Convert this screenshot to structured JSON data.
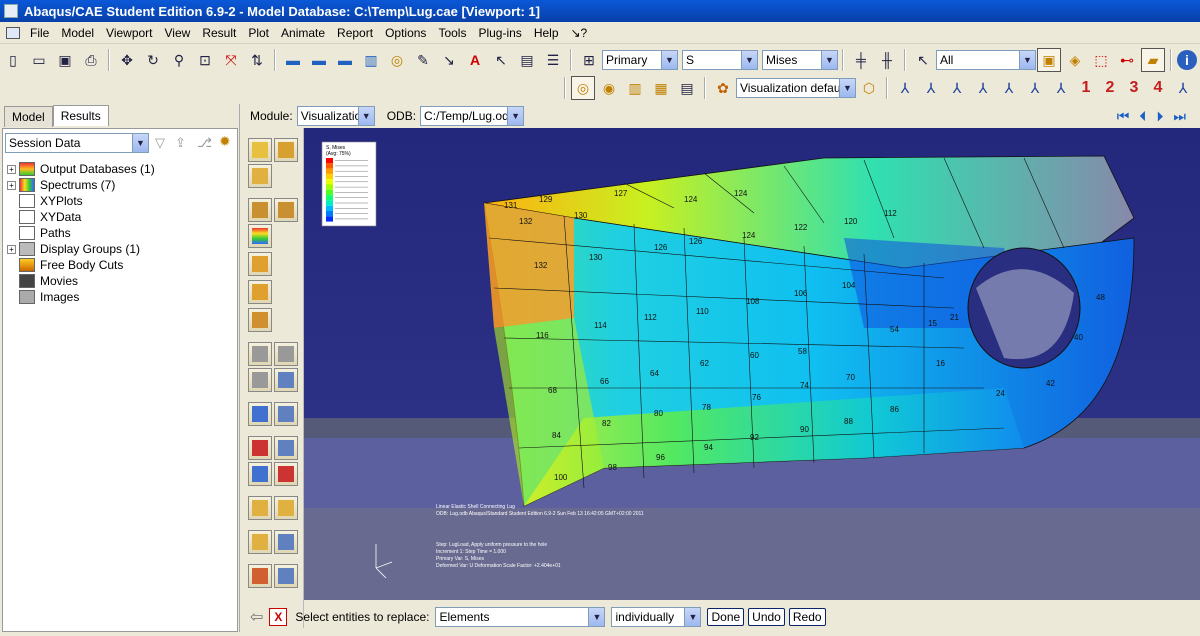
{
  "window": {
    "title": "Abaqus/CAE Student Edition 6.9-2 - Model Database: C:\\Temp\\Lug.cae [Viewport: 1]"
  },
  "menu": [
    "File",
    "Model",
    "Viewport",
    "View",
    "Result",
    "Plot",
    "Animate",
    "Report",
    "Options",
    "Tools",
    "Plug-ins",
    "Help",
    "↘?"
  ],
  "toolbar": {
    "step_combo": "Primary",
    "variable_combo": "S",
    "invariant_combo": "Mises",
    "selection_combo": "All",
    "visualization_combo": "Visualization defaults",
    "view_numbers": [
      "1",
      "2",
      "3",
      "4"
    ]
  },
  "left_panel": {
    "tabs": [
      "Model",
      "Results"
    ],
    "session_combo": "Session Data",
    "tree": [
      {
        "label": "Output Databases (1)",
        "expandable": true
      },
      {
        "label": "Spectrums (7)",
        "expandable": true
      },
      {
        "label": "XYPlots",
        "expandable": false
      },
      {
        "label": "XYData",
        "expandable": false
      },
      {
        "label": "Paths",
        "expandable": false
      },
      {
        "label": "Display Groups (1)",
        "expandable": true
      },
      {
        "label": "Free Body Cuts",
        "expandable": false
      },
      {
        "label": "Movies",
        "expandable": false
      },
      {
        "label": "Images",
        "expandable": false
      }
    ]
  },
  "context": {
    "module_label": "Module:",
    "module_value": "Visualization",
    "odb_label": "ODB:",
    "odb_value": "C:/Temp/Lug.odb"
  },
  "viewport": {
    "legend_title": "S, Mises",
    "legend_subtitle": "(Avg: 75%)",
    "legend_colors": [
      "#ff0000",
      "#ff5a00",
      "#ff9a00",
      "#ffd000",
      "#e8ff00",
      "#a0ff00",
      "#50ff20",
      "#10ff70",
      "#00f0c0",
      "#00b8ff",
      "#0078ff",
      "#0030ff"
    ],
    "element_labels": [
      {
        "t": "131"
      },
      {
        "t": "129"
      },
      {
        "t": "130"
      },
      {
        "t": "127"
      },
      {
        "t": "124"
      },
      {
        "t": "124"
      },
      {
        "t": "126"
      },
      {
        "t": "124"
      },
      {
        "t": "122"
      },
      {
        "t": "120"
      },
      {
        "t": "112"
      },
      {
        "t": "132"
      },
      {
        "t": "132"
      },
      {
        "t": "130"
      },
      {
        "t": "126"
      },
      {
        "t": "114"
      },
      {
        "t": "112"
      },
      {
        "t": "110"
      },
      {
        "t": "108"
      },
      {
        "t": "106"
      },
      {
        "t": "104"
      },
      {
        "t": "116"
      },
      {
        "t": "68"
      },
      {
        "t": "66"
      },
      {
        "t": "64"
      },
      {
        "t": "62"
      },
      {
        "t": "60"
      },
      {
        "t": "58"
      },
      {
        "t": "70"
      },
      {
        "t": "74"
      },
      {
        "t": "76"
      },
      {
        "t": "78"
      },
      {
        "t": "80"
      },
      {
        "t": "82"
      },
      {
        "t": "84"
      },
      {
        "t": "86"
      },
      {
        "t": "88"
      },
      {
        "t": "90"
      },
      {
        "t": "92"
      },
      {
        "t": "94"
      },
      {
        "t": "96"
      },
      {
        "t": "98"
      },
      {
        "t": "100"
      },
      {
        "t": "54"
      },
      {
        "t": "15"
      },
      {
        "t": "21"
      },
      {
        "t": "16"
      },
      {
        "t": "24"
      },
      {
        "t": "42"
      },
      {
        "t": "40"
      },
      {
        "t": "48"
      }
    ],
    "info_line1": "Linear Elastic Shell Connecting Lug",
    "info_line2": "ODB: Lug.odb    Abaqus/Standard Student Edition 6.9-2    Sun Feb 13 16:42:05 GMT+02:00 2011",
    "info_line3": "Step: LugLoad, Apply uniform pressure to the hole",
    "info_line4": "Increment    1: Step Time =    1.000",
    "info_line5": "Primary Var: S, Mises",
    "info_line6": "Deformed Var: U   Deformation Scale Factor: +2.404e+01"
  },
  "prompt": {
    "text": "Select entities to replace:",
    "entity_combo": "Elements",
    "method_combo": "individually",
    "done": "Done",
    "undo": "Undo",
    "redo": "Redo"
  }
}
